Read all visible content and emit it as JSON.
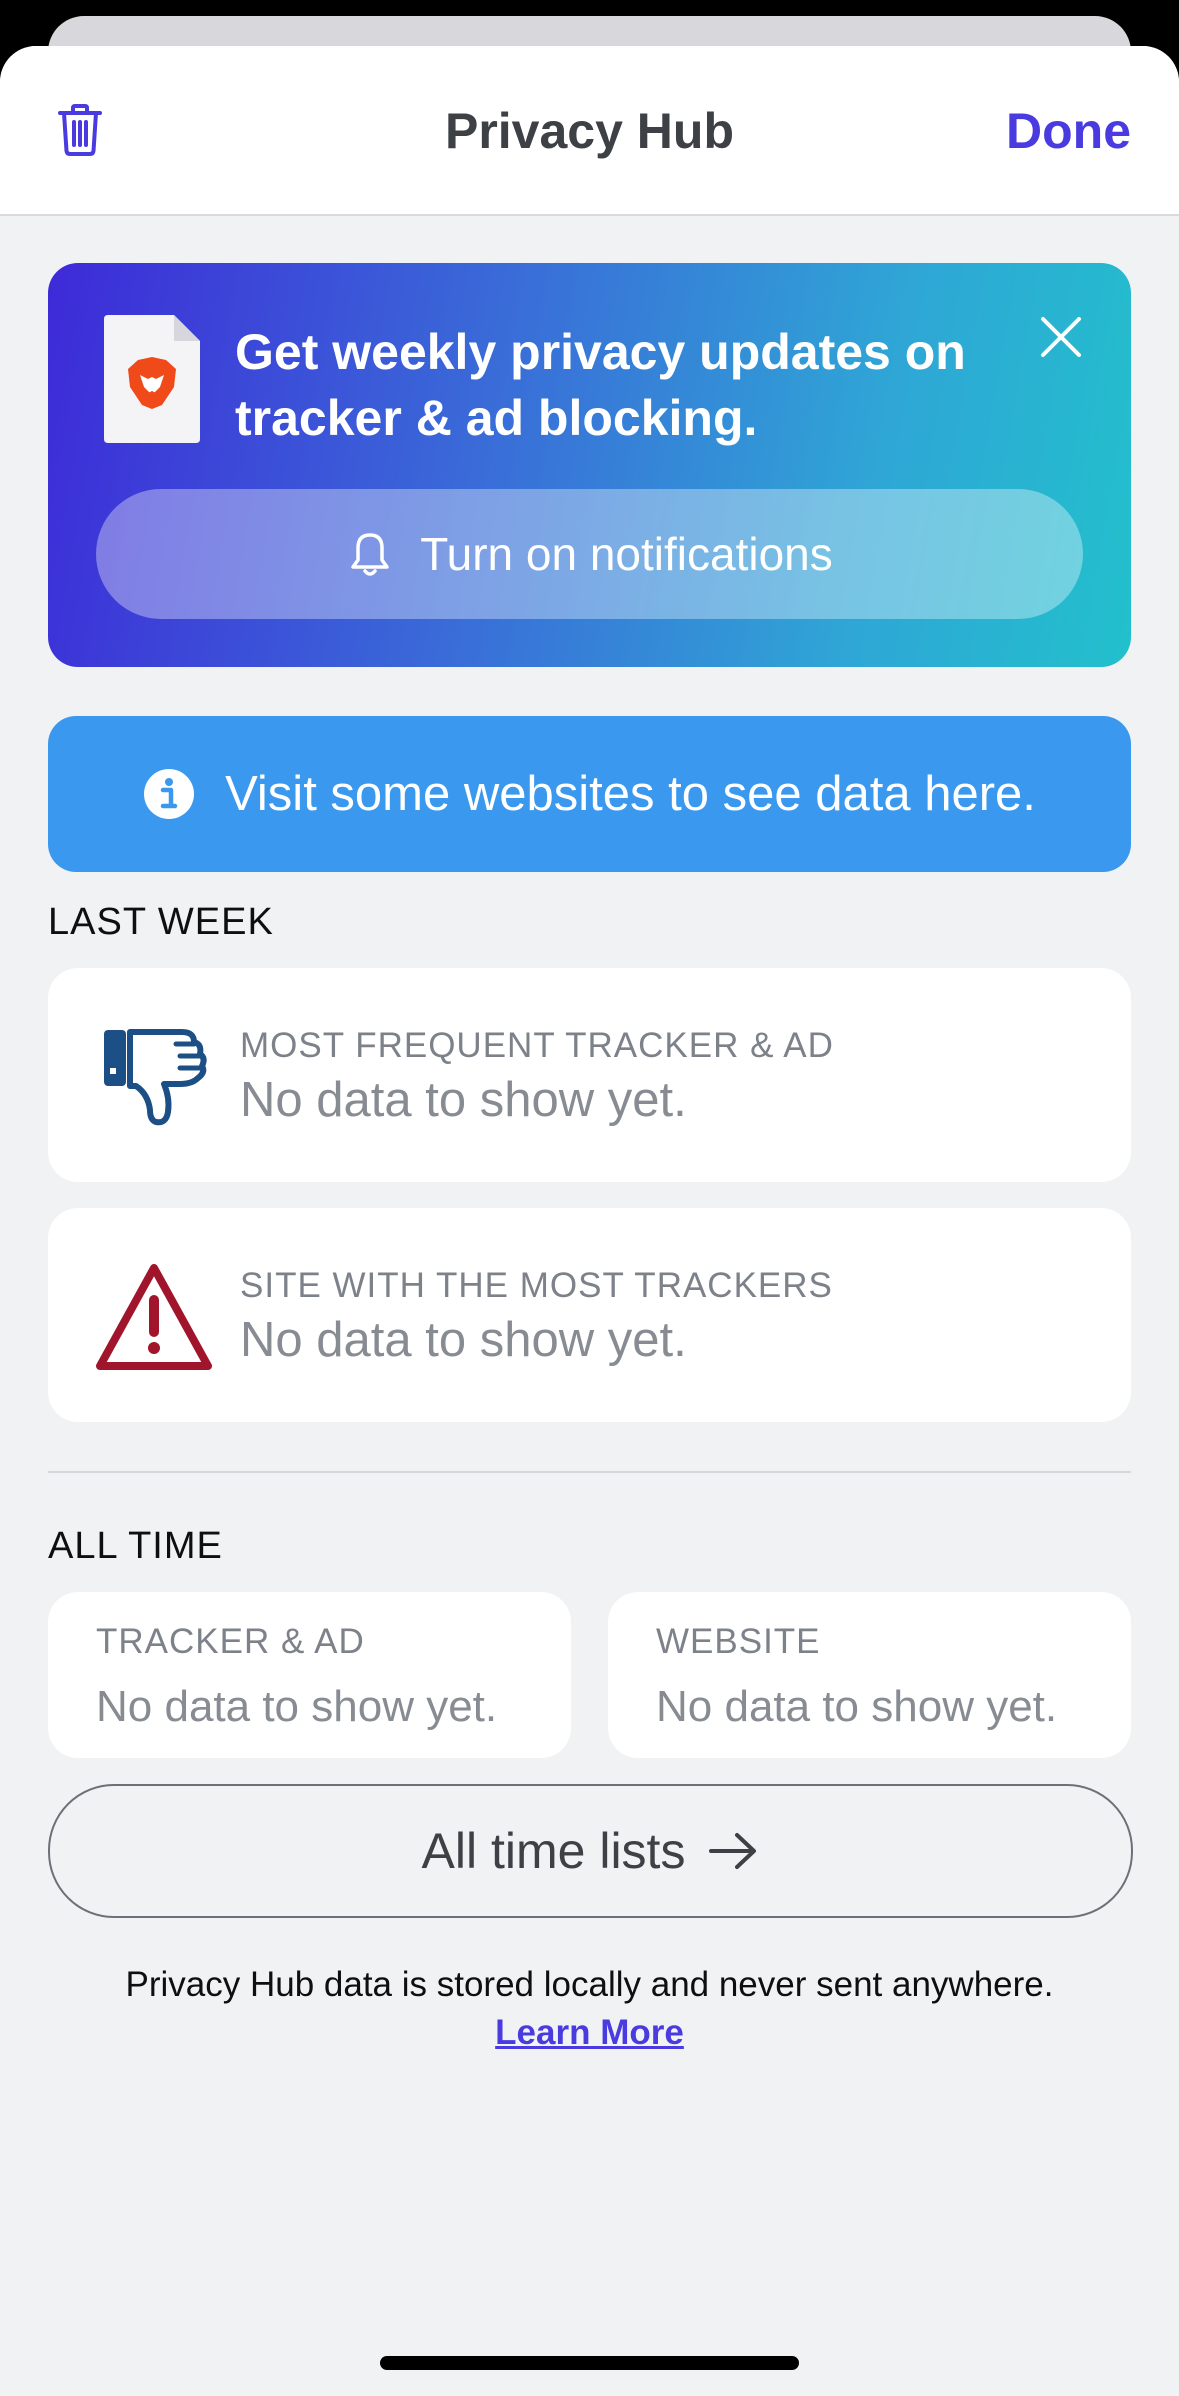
{
  "header": {
    "title": "Privacy Hub",
    "done_label": "Done",
    "trash_icon": "trash-icon"
  },
  "promo": {
    "text": "Get weekly privacy updates on tracker & ad blocking.",
    "button_label": "Turn on notifications",
    "icons": [
      "brave-document-icon",
      "close-icon",
      "bell-icon"
    ],
    "gradient": [
      "#3d2ad8",
      "#22c0cc"
    ]
  },
  "info_banner": {
    "text": "Visit some websites to see data here.",
    "icon": "info-icon",
    "color": "#3a98ee"
  },
  "last_week": {
    "label": "LAST WEEK",
    "cards": [
      {
        "title": "MOST FREQUENT TRACKER & AD",
        "value": "No data to show yet.",
        "icon": "thumbs-down-icon"
      },
      {
        "title": "SITE WITH THE MOST TRACKERS",
        "value": "No data to show yet.",
        "icon": "warning-icon"
      }
    ]
  },
  "all_time": {
    "label": "ALL TIME",
    "cards": [
      {
        "title": "TRACKER & AD",
        "value": "No data to show yet."
      },
      {
        "title": "WEBSITE",
        "value": "No data to show yet."
      }
    ],
    "lists_button": "All time lists",
    "arrow_icon": "arrow-right-icon"
  },
  "footer": {
    "note": "Privacy Hub data is stored locally and never sent anywhere.",
    "learn_more": "Learn More"
  },
  "colors": {
    "accent": "#4a3be0",
    "background": "#f1f2f4",
    "warning": "#a0152b",
    "thumbs": "#1c4f86"
  }
}
